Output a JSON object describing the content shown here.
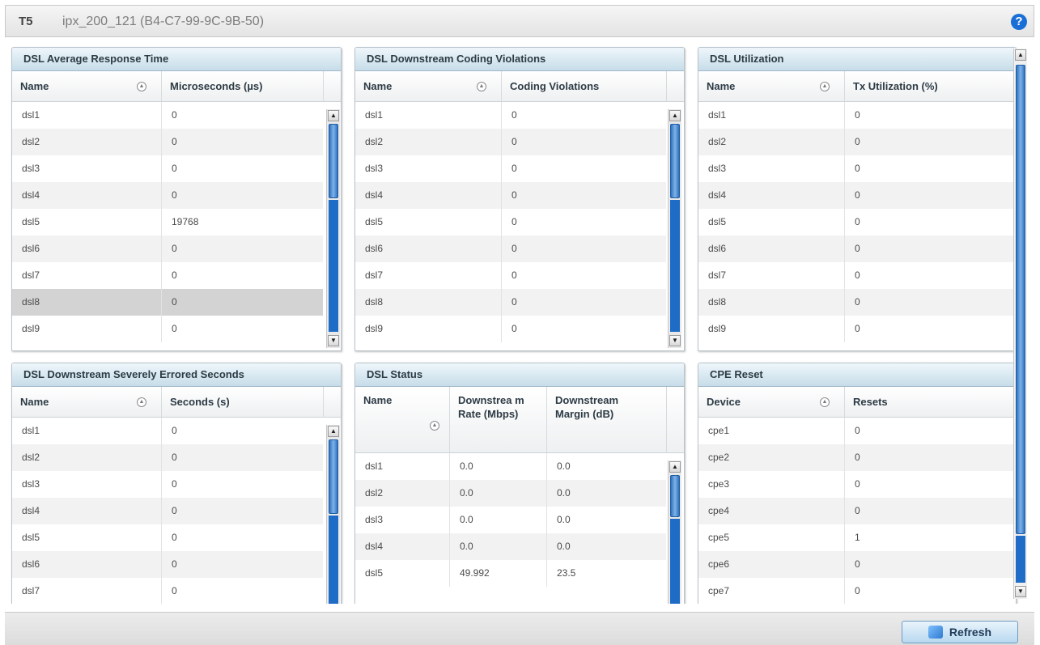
{
  "header": {
    "device_id": "T5",
    "device_name": "ipx_200_121 (B4-C7-99-9C-9B-50)",
    "help_icon": "?"
  },
  "panels": {
    "avg_resp": {
      "title": "DSL Average Response Time",
      "columns": [
        "Name",
        "Microseconds (µs)"
      ],
      "rows": [
        [
          "dsl1",
          "0"
        ],
        [
          "dsl2",
          "0"
        ],
        [
          "dsl3",
          "0"
        ],
        [
          "dsl4",
          "0"
        ],
        [
          "dsl5",
          "19768"
        ],
        [
          "dsl6",
          "0"
        ],
        [
          "dsl7",
          "0"
        ],
        [
          "dsl8",
          "0"
        ],
        [
          "dsl9",
          "0"
        ]
      ]
    },
    "coding": {
      "title": "DSL Downstream Coding Violations",
      "columns": [
        "Name",
        "Coding Violations"
      ],
      "rows": [
        [
          "dsl1",
          "0"
        ],
        [
          "dsl2",
          "0"
        ],
        [
          "dsl3",
          "0"
        ],
        [
          "dsl4",
          "0"
        ],
        [
          "dsl5",
          "0"
        ],
        [
          "dsl6",
          "0"
        ],
        [
          "dsl7",
          "0"
        ],
        [
          "dsl8",
          "0"
        ],
        [
          "dsl9",
          "0"
        ]
      ]
    },
    "util": {
      "title": "DSL Utilization",
      "columns": [
        "Name",
        "Tx Utilization (%)"
      ],
      "rows": [
        [
          "dsl1",
          "0"
        ],
        [
          "dsl2",
          "0"
        ],
        [
          "dsl3",
          "0"
        ],
        [
          "dsl4",
          "0"
        ],
        [
          "dsl5",
          "0"
        ],
        [
          "dsl6",
          "0"
        ],
        [
          "dsl7",
          "0"
        ],
        [
          "dsl8",
          "0"
        ],
        [
          "dsl9",
          "0"
        ]
      ]
    },
    "errored": {
      "title": "DSL Downstream Severely Errored Seconds",
      "columns": [
        "Name",
        "Seconds (s)"
      ],
      "rows": [
        [
          "dsl1",
          "0"
        ],
        [
          "dsl2",
          "0"
        ],
        [
          "dsl3",
          "0"
        ],
        [
          "dsl4",
          "0"
        ],
        [
          "dsl5",
          "0"
        ],
        [
          "dsl6",
          "0"
        ],
        [
          "dsl7",
          "0"
        ]
      ]
    },
    "status": {
      "title": "DSL Status",
      "columns": [
        "Name",
        "Downstrea m Rate (Mbps)",
        "Downstream Margin (dB)"
      ],
      "rows": [
        [
          "dsl1",
          "0.0",
          "0.0"
        ],
        [
          "dsl2",
          "0.0",
          "0.0"
        ],
        [
          "dsl3",
          "0.0",
          "0.0"
        ],
        [
          "dsl4",
          "0.0",
          "0.0"
        ],
        [
          "dsl5",
          "49.992",
          "23.5"
        ]
      ]
    },
    "cpe": {
      "title": "CPE Reset",
      "columns": [
        "Device",
        "Resets"
      ],
      "rows": [
        [
          "cpe1",
          "0"
        ],
        [
          "cpe2",
          "0"
        ],
        [
          "cpe3",
          "0"
        ],
        [
          "cpe4",
          "0"
        ],
        [
          "cpe5",
          "1"
        ],
        [
          "cpe6",
          "0"
        ],
        [
          "cpe7",
          "0"
        ]
      ]
    }
  },
  "footer": {
    "refresh_label": "Refresh"
  },
  "icons": {
    "sort": "sort-ascending-icon",
    "scroll_up": "▲",
    "scroll_down": "▼",
    "refresh": "refresh-icon"
  }
}
